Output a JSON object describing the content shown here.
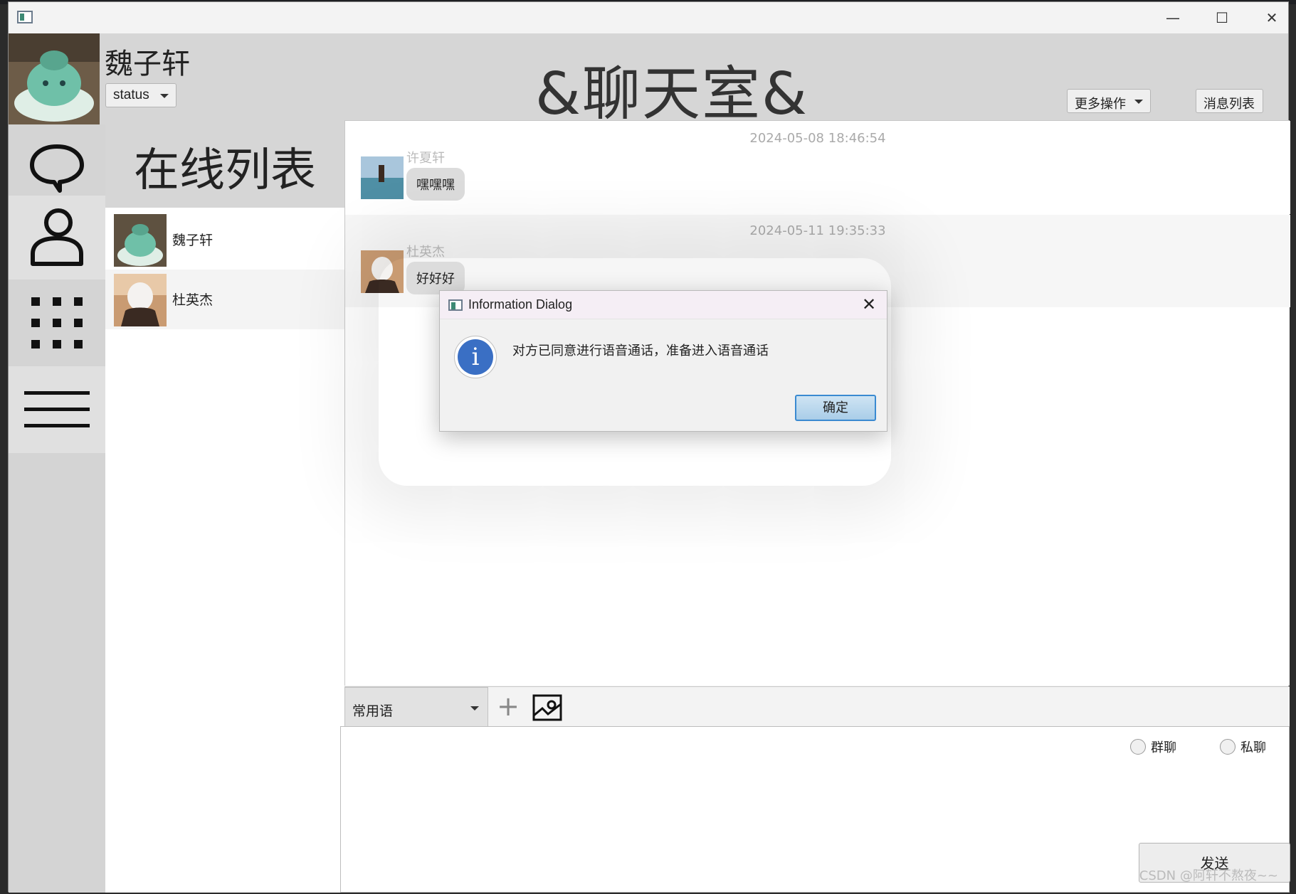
{
  "window": {
    "minimize": "—",
    "maximize": "☐",
    "close": "✕"
  },
  "header": {
    "username": "魏子轩",
    "status_label": "status",
    "room_title": "&聊天室&",
    "more_actions": "更多操作",
    "message_list": "消息列表"
  },
  "nav": {
    "items": [
      "chat-bubble-icon",
      "user-icon",
      "apps-grid-icon",
      "menu-icon"
    ]
  },
  "online": {
    "title": "在线列表",
    "users": [
      {
        "name": "魏子轩"
      },
      {
        "name": "杜英杰"
      }
    ]
  },
  "chat": {
    "messages": [
      {
        "time": "2024-05-08 18:46:54",
        "sender": "许夏轩",
        "text": "嘿嘿嘿"
      },
      {
        "time": "2024-05-11 19:35:33",
        "sender": "杜英杰",
        "text": "好好好"
      }
    ]
  },
  "toolbar": {
    "phrase_select": "常用语",
    "add_icon": "plus-icon",
    "image_icon": "image-icon"
  },
  "compose": {
    "group_chat": "群聊",
    "private_chat": "私聊",
    "send": "发送"
  },
  "dialog": {
    "title": "Information Dialog",
    "message": "对方已同意进行语音通话，准备进入语音通话",
    "ok": "确定",
    "info_icon_glyph": "i"
  },
  "watermark": "CSDN @阿轩不熬夜~~"
}
